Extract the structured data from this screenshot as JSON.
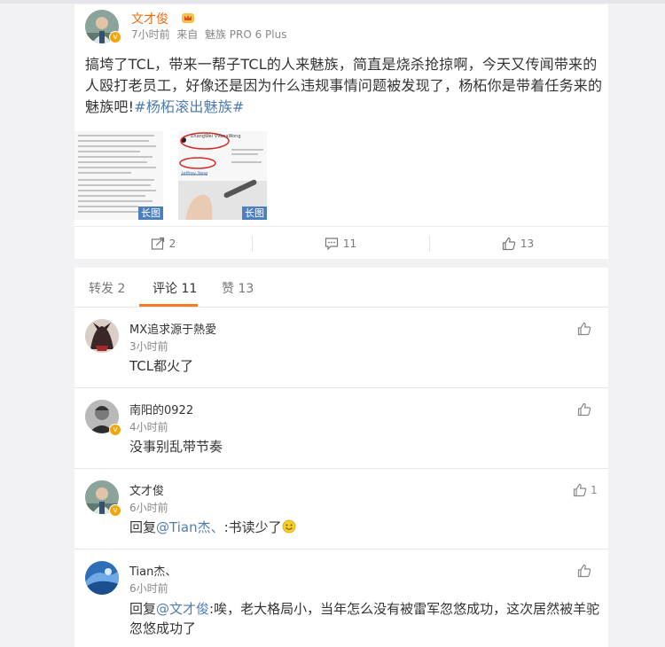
{
  "post": {
    "author": "文才俊",
    "time": "7小时前",
    "source_prefix": "来自",
    "source": "魅族 PRO 6 Plus",
    "content_text": "搞垮了TCL，带来一帮子TCL的人来魅族，简直是烧杀抢掠啊，今天又传闻带来的人殴打老员工，好像还是因为什么违规事情问题被发现了，杨柘你是带着任务来的魅族吧!",
    "hashtag": "#杨柘滚出魅族#",
    "images": [
      {
        "badge": "长图"
      },
      {
        "badge": "长图",
        "caption_small": "ZhangWei VVanaWong",
        "caption_small_2": "Jeffrey Yang"
      }
    ],
    "actions": {
      "repost_count": "2",
      "comment_count": "11",
      "like_count": "13"
    }
  },
  "tabs": [
    {
      "label": "转发 2"
    },
    {
      "label": "评论 11"
    },
    {
      "label": "赞 13"
    }
  ],
  "active_tab": "评论 11",
  "comments": [
    {
      "name": "MX追求源于熱愛",
      "time": "3小时前",
      "text": "TCL都火了",
      "likes": ""
    },
    {
      "name": "南阳的0922",
      "time": "4小时前",
      "text": "没事别乱带节奏",
      "likes": ""
    },
    {
      "name": "文才俊",
      "time": "6小时前",
      "reply_prefix": "回复",
      "reply_to": "@Tian杰、",
      "text": ":书读少了",
      "likes": "1"
    },
    {
      "name": "Tian杰、",
      "time": "6小时前",
      "reply_prefix": "回复",
      "reply_to": "@文才俊",
      "text": ":唉，老大格局小，当年怎么没有被雷军忽悠成功，这次居然被羊驼忽悠成功了",
      "likes": ""
    }
  ],
  "colors": {
    "name_orange": "#e86b0f",
    "link_blue": "#507daf",
    "tab_underline": "#f77c1f",
    "badge_gold": "#f2a60c",
    "background": "#f2f2f5"
  },
  "icons": {
    "repost": "repost-icon",
    "comment": "comment-icon",
    "like": "thumbs-up-icon",
    "vip": "vip-crown-icon",
    "verified": "verified-badge-icon"
  }
}
